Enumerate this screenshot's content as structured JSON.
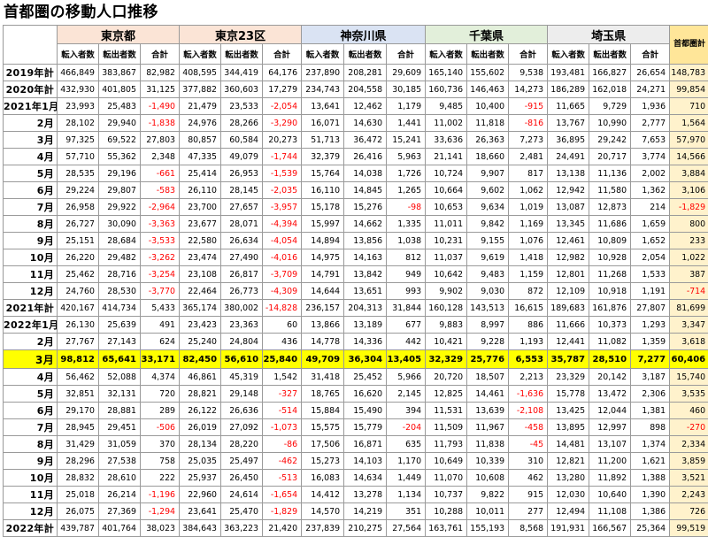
{
  "title": "首都圏の移動人口推移",
  "groups": [
    {
      "label": "東京都",
      "cls": "g-tokyo"
    },
    {
      "label": "東京23区",
      "cls": "g-k23"
    },
    {
      "label": "神奈川県",
      "cls": "g-kana"
    },
    {
      "label": "千葉県",
      "cls": "g-chiba"
    },
    {
      "label": "埼玉県",
      "cls": "g-sai"
    }
  ],
  "capital_header": "首都圏計",
  "subheaders": [
    "転入者数",
    "転出者数",
    "合計"
  ],
  "rows": [
    {
      "label": "2019年計",
      "values": [
        "466,849",
        "383,867",
        "82,982",
        "408,595",
        "344,419",
        "64,176",
        "237,890",
        "208,281",
        "29,609",
        "165,140",
        "155,602",
        "9,538",
        "193,481",
        "166,827",
        "26,654",
        "148,783"
      ]
    },
    {
      "label": "2020年計",
      "values": [
        "432,930",
        "401,805",
        "31,125",
        "377,882",
        "360,603",
        "17,279",
        "234,743",
        "204,558",
        "30,185",
        "160,736",
        "146,463",
        "14,273",
        "186,289",
        "162,018",
        "24,271",
        "99,854"
      ]
    },
    {
      "label": "2021年1月",
      "values": [
        "23,993",
        "25,483",
        "-1,490",
        "21,479",
        "23,533",
        "-2,054",
        "13,641",
        "12,462",
        "1,179",
        "9,485",
        "10,400",
        "-915",
        "11,665",
        "9,729",
        "1,936",
        "710"
      ]
    },
    {
      "label": "2月",
      "values": [
        "28,102",
        "29,940",
        "-1,838",
        "24,976",
        "28,266",
        "-3,290",
        "16,071",
        "14,630",
        "1,441",
        "11,002",
        "11,818",
        "-816",
        "13,767",
        "10,990",
        "2,777",
        "1,564"
      ]
    },
    {
      "label": "3月",
      "values": [
        "97,325",
        "69,522",
        "27,803",
        "80,857",
        "60,584",
        "20,273",
        "51,713",
        "36,472",
        "15,241",
        "33,636",
        "26,363",
        "7,273",
        "36,895",
        "29,242",
        "7,653",
        "57,970"
      ]
    },
    {
      "label": "4月",
      "values": [
        "57,710",
        "55,362",
        "2,348",
        "47,335",
        "49,079",
        "-1,744",
        "32,379",
        "26,416",
        "5,963",
        "21,141",
        "18,660",
        "2,481",
        "24,491",
        "20,717",
        "3,774",
        "14,566"
      ]
    },
    {
      "label": "5月",
      "values": [
        "28,535",
        "29,196",
        "-661",
        "25,414",
        "26,953",
        "-1,539",
        "15,764",
        "14,038",
        "1,726",
        "10,724",
        "9,907",
        "817",
        "13,138",
        "11,136",
        "2,002",
        "3,884"
      ]
    },
    {
      "label": "6月",
      "values": [
        "29,224",
        "29,807",
        "-583",
        "26,110",
        "28,145",
        "-2,035",
        "16,110",
        "14,845",
        "1,265",
        "10,664",
        "9,602",
        "1,062",
        "12,942",
        "11,580",
        "1,362",
        "3,106"
      ]
    },
    {
      "label": "7月",
      "values": [
        "26,958",
        "29,922",
        "-2,964",
        "23,700",
        "27,657",
        "-3,957",
        "15,178",
        "15,276",
        "-98",
        "10,653",
        "9,634",
        "1,019",
        "13,087",
        "12,873",
        "214",
        "-1,829"
      ]
    },
    {
      "label": "8月",
      "values": [
        "26,727",
        "30,090",
        "-3,363",
        "23,677",
        "28,071",
        "-4,394",
        "15,997",
        "14,662",
        "1,335",
        "11,011",
        "9,842",
        "1,169",
        "13,345",
        "11,686",
        "1,659",
        "800"
      ]
    },
    {
      "label": "9月",
      "values": [
        "25,151",
        "28,684",
        "-3,533",
        "22,580",
        "26,634",
        "-4,054",
        "14,894",
        "13,856",
        "1,038",
        "10,231",
        "9,155",
        "1,076",
        "12,461",
        "10,809",
        "1,652",
        "233"
      ]
    },
    {
      "label": "10月",
      "values": [
        "26,220",
        "29,482",
        "-3,262",
        "23,474",
        "27,490",
        "-4,016",
        "14,975",
        "14,163",
        "812",
        "11,037",
        "9,619",
        "1,418",
        "12,982",
        "10,928",
        "2,054",
        "1,022"
      ]
    },
    {
      "label": "11月",
      "values": [
        "25,462",
        "28,716",
        "-3,254",
        "23,108",
        "26,817",
        "-3,709",
        "14,791",
        "13,842",
        "949",
        "10,642",
        "9,483",
        "1,159",
        "12,801",
        "11,268",
        "1,533",
        "387"
      ]
    },
    {
      "label": "12月",
      "values": [
        "24,760",
        "28,530",
        "-3,770",
        "22,464",
        "26,773",
        "-4,309",
        "14,644",
        "13,651",
        "993",
        "9,902",
        "9,030",
        "872",
        "12,109",
        "10,918",
        "1,191",
        "-714"
      ]
    },
    {
      "label": "2021年計",
      "values": [
        "420,167",
        "414,734",
        "5,433",
        "365,174",
        "380,002",
        "-14,828",
        "236,157",
        "204,313",
        "31,844",
        "160,128",
        "143,513",
        "16,615",
        "189,683",
        "161,876",
        "27,807",
        "81,699"
      ]
    },
    {
      "label": "2022年1月",
      "values": [
        "26,130",
        "25,639",
        "491",
        "23,423",
        "23,363",
        "60",
        "13,866",
        "13,189",
        "677",
        "9,883",
        "8,997",
        "886",
        "11,666",
        "10,373",
        "1,293",
        "3,347"
      ]
    },
    {
      "label": "2月",
      "values": [
        "27,767",
        "27,143",
        "624",
        "25,240",
        "24,804",
        "436",
        "14,778",
        "14,336",
        "442",
        "10,421",
        "9,228",
        "1,193",
        "12,441",
        "11,082",
        "1,359",
        "3,618"
      ]
    },
    {
      "label": "3月",
      "highlight": true,
      "values": [
        "98,812",
        "65,641",
        "33,171",
        "82,450",
        "56,610",
        "25,840",
        "49,709",
        "36,304",
        "13,405",
        "32,329",
        "25,776",
        "6,553",
        "35,787",
        "28,510",
        "7,277",
        "60,406"
      ]
    },
    {
      "label": "4月",
      "values": [
        "56,462",
        "52,088",
        "4,374",
        "46,861",
        "45,319",
        "1,542",
        "31,418",
        "25,452",
        "5,966",
        "20,720",
        "18,507",
        "2,213",
        "23,329",
        "20,142",
        "3,187",
        "15,740"
      ]
    },
    {
      "label": "5月",
      "values": [
        "32,851",
        "32,131",
        "720",
        "28,821",
        "29,148",
        "-327",
        "18,765",
        "16,620",
        "2,145",
        "12,825",
        "14,461",
        "-1,636",
        "15,778",
        "13,472",
        "2,306",
        "3,535"
      ]
    },
    {
      "label": "6月",
      "values": [
        "29,170",
        "28,881",
        "289",
        "26,122",
        "26,636",
        "-514",
        "15,884",
        "15,490",
        "394",
        "11,531",
        "13,639",
        "-2,108",
        "13,425",
        "12,044",
        "1,381",
        "460"
      ]
    },
    {
      "label": "7月",
      "values": [
        "28,945",
        "29,451",
        "-506",
        "26,019",
        "27,092",
        "-1,073",
        "15,575",
        "15,779",
        "-204",
        "11,509",
        "11,967",
        "-458",
        "13,895",
        "12,997",
        "898",
        "-270"
      ]
    },
    {
      "label": "8月",
      "values": [
        "31,429",
        "31,059",
        "370",
        "28,134",
        "28,220",
        "-86",
        "17,506",
        "16,871",
        "635",
        "11,793",
        "11,838",
        "-45",
        "14,481",
        "13,107",
        "1,374",
        "2,334"
      ]
    },
    {
      "label": "9月",
      "values": [
        "28,296",
        "27,538",
        "758",
        "25,035",
        "25,497",
        "-462",
        "15,273",
        "14,103",
        "1,170",
        "10,649",
        "10,339",
        "310",
        "12,821",
        "11,200",
        "1,621",
        "3,859"
      ]
    },
    {
      "label": "10月",
      "values": [
        "28,832",
        "28,610",
        "222",
        "25,937",
        "26,450",
        "-513",
        "16,083",
        "14,634",
        "1,449",
        "11,070",
        "10,608",
        "462",
        "13,280",
        "11,892",
        "1,388",
        "3,521"
      ]
    },
    {
      "label": "11月",
      "values": [
        "25,018",
        "26,214",
        "-1,196",
        "22,960",
        "24,614",
        "-1,654",
        "14,412",
        "13,278",
        "1,134",
        "10,737",
        "9,822",
        "915",
        "12,030",
        "10,640",
        "1,390",
        "2,243"
      ]
    },
    {
      "label": "12月",
      "values": [
        "26,075",
        "27,369",
        "-1,294",
        "23,641",
        "25,470",
        "-1,829",
        "14,570",
        "14,219",
        "351",
        "10,288",
        "10,011",
        "277",
        "12,494",
        "11,108",
        "1,386",
        "726"
      ]
    },
    {
      "label": "2022年計",
      "values": [
        "439,787",
        "401,764",
        "38,023",
        "384,643",
        "363,223",
        "21,420",
        "237,839",
        "210,275",
        "27,564",
        "163,761",
        "155,193",
        "8,568",
        "191,931",
        "166,567",
        "25,364",
        "99,519"
      ]
    }
  ]
}
